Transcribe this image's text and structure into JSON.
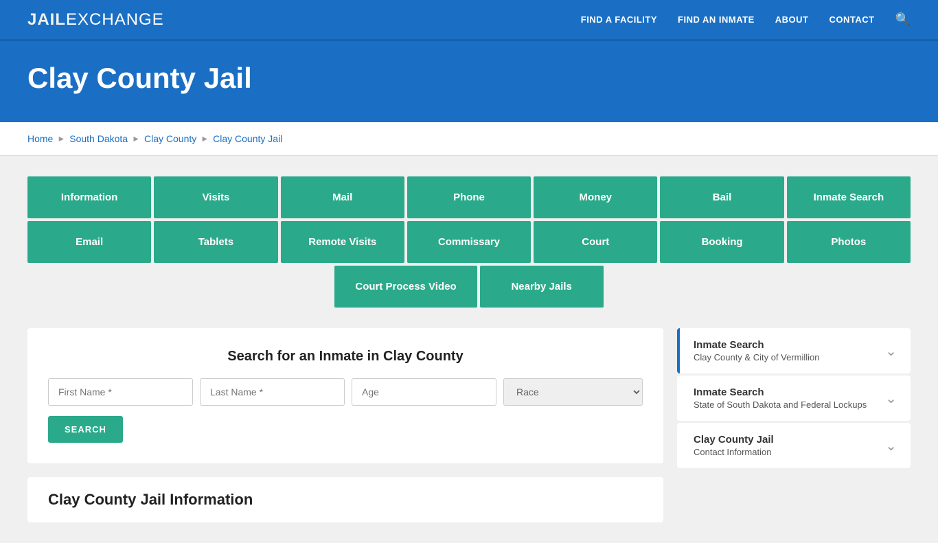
{
  "header": {
    "logo_jail": "JAIL",
    "logo_exchange": "EXCHANGE",
    "nav": [
      {
        "label": "FIND A FACILITY",
        "id": "find-facility"
      },
      {
        "label": "FIND AN INMATE",
        "id": "find-inmate"
      },
      {
        "label": "ABOUT",
        "id": "about"
      },
      {
        "label": "CONTACT",
        "id": "contact"
      }
    ]
  },
  "hero": {
    "title": "Clay County Jail"
  },
  "breadcrumb": {
    "items": [
      "Home",
      "South Dakota",
      "Clay County",
      "Clay County Jail"
    ]
  },
  "tiles_row1": [
    {
      "label": "Information"
    },
    {
      "label": "Visits"
    },
    {
      "label": "Mail"
    },
    {
      "label": "Phone"
    },
    {
      "label": "Money"
    },
    {
      "label": "Bail"
    },
    {
      "label": "Inmate Search"
    }
  ],
  "tiles_row2": [
    {
      "label": "Email"
    },
    {
      "label": "Tablets"
    },
    {
      "label": "Remote Visits"
    },
    {
      "label": "Commissary"
    },
    {
      "label": "Court"
    },
    {
      "label": "Booking"
    },
    {
      "label": "Photos"
    }
  ],
  "tiles_row3": [
    {
      "label": "Court Process Video"
    },
    {
      "label": "Nearby Jails"
    }
  ],
  "search": {
    "title": "Search for an Inmate in Clay County",
    "first_name_placeholder": "First Name *",
    "last_name_placeholder": "Last Name *",
    "age_placeholder": "Age",
    "race_placeholder": "Race",
    "search_button": "SEARCH"
  },
  "info_section": {
    "title": "Clay County Jail Information"
  },
  "sidebar": {
    "cards": [
      {
        "title": "Inmate Search",
        "subtitle": "Clay County & City of Vermillion",
        "active": true
      },
      {
        "title": "Inmate Search",
        "subtitle": "State of South Dakota and Federal Lockups",
        "active": false
      },
      {
        "title": "Clay County Jail",
        "subtitle": "Contact Information",
        "active": false
      }
    ]
  }
}
